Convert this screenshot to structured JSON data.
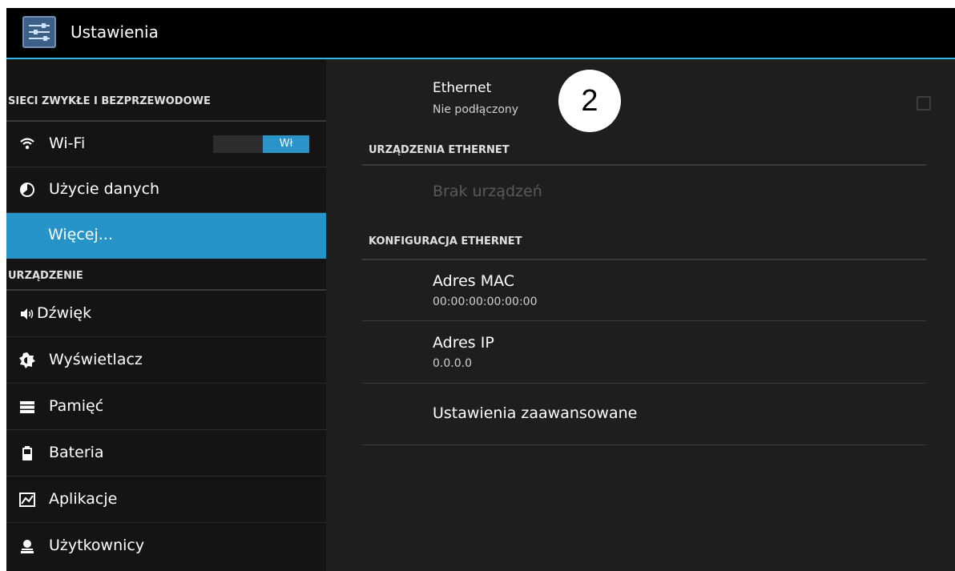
{
  "app": {
    "title": "Ustawienia",
    "icon": "settings-sliders-icon"
  },
  "sidebar": {
    "headers": [
      "SIECI ZWYKŁE I BEZPRZEWODOWE",
      "URZĄDZENIE"
    ],
    "items": [
      {
        "label": "Wi-Fi",
        "icon": "wifi-icon",
        "toggle": "Wł"
      },
      {
        "label": "Użycie danych",
        "icon": "data-usage-icon"
      },
      {
        "label": "Więcej...",
        "icon": "",
        "selected": true
      },
      {
        "label": "Dźwięk",
        "icon": "speaker-icon"
      },
      {
        "label": "Wyświetlacz",
        "icon": "brightness-icon"
      },
      {
        "label": "Pamięć",
        "icon": "storage-icon"
      },
      {
        "label": "Bateria",
        "icon": "battery-icon"
      },
      {
        "label": "Aplikacje",
        "icon": "apps-icon"
      },
      {
        "label": "Użytkownicy",
        "icon": "users-icon"
      }
    ]
  },
  "main": {
    "ethernet": {
      "title": "Ethernet",
      "status": "Nie podłączony",
      "checked": false
    },
    "devices_header": "URZĄDZENIA ETHERNET",
    "no_devices": "Brak urządzeń",
    "config_header": "KONFIGURACJA ETHERNET",
    "mac": {
      "label": "Adres MAC",
      "value": "00:00:00:00:00:00"
    },
    "ip": {
      "label": "Adres IP",
      "value": "0.0.0.0"
    },
    "advanced": "Ustawienia zaawansowane"
  },
  "callout": {
    "number": "2"
  },
  "colors": {
    "accent": "#33b5e5",
    "selected": "#2694c8",
    "background": "#1e1e1e"
  }
}
